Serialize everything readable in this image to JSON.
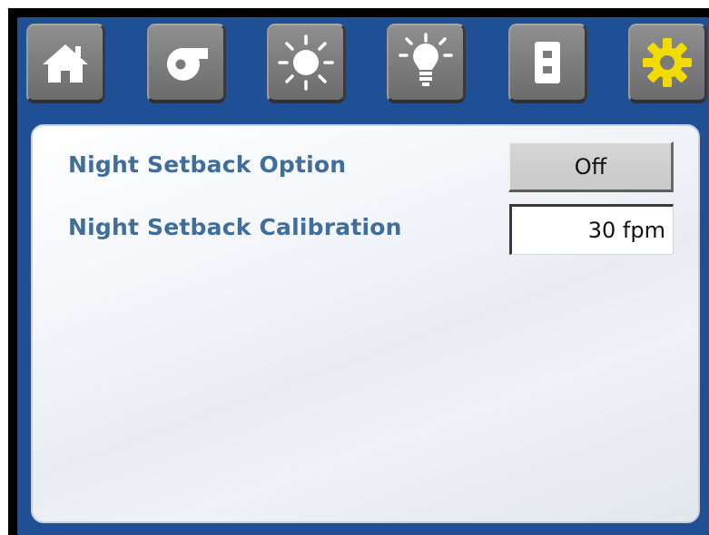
{
  "toolbar": {
    "buttons": [
      {
        "icon": "home-icon",
        "color": "#ffffff"
      },
      {
        "icon": "blower-fan-icon",
        "color": "#ffffff"
      },
      {
        "icon": "sun-icon",
        "color": "#ffffff"
      },
      {
        "icon": "light-bulb-icon",
        "color": "#ffffff"
      },
      {
        "icon": "wall-switch-icon",
        "color": "#ffffff"
      },
      {
        "icon": "gear-icon",
        "color": "#f2dc00",
        "selected": true
      }
    ]
  },
  "settings": {
    "night_setback_option": {
      "label": "Night Setback Option",
      "value": "Off"
    },
    "night_setback_calibration": {
      "label": "Night Setback Calibration",
      "value": "30 fpm"
    }
  },
  "colors": {
    "frame_blue": "#1f4f94",
    "label_blue": "#3f6e9c",
    "button_gray": "#7f7f7f",
    "selected_gear_yellow": "#f2dc00"
  }
}
